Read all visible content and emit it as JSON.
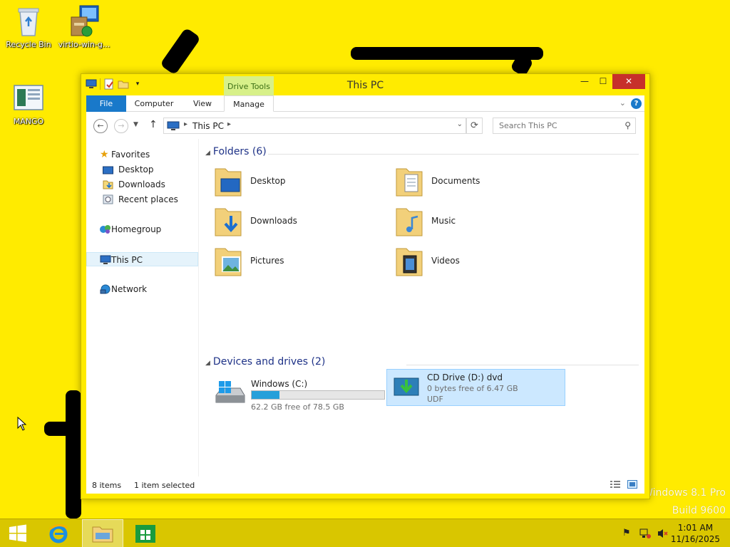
{
  "desktop": {
    "icons": [
      {
        "label": "Recycle Bin",
        "icon": "recycle-bin-icon"
      },
      {
        "label": "virtio-win-g...",
        "icon": "installer-icon"
      },
      {
        "label": "MANGO",
        "icon": "document-icon"
      }
    ],
    "watermark": {
      "line1": "Windows 8.1 Pro",
      "line2": "Build 9600"
    }
  },
  "window": {
    "title": "This PC",
    "context_tab": "Drive Tools",
    "controls": {
      "minimize": "—",
      "maximize": "☐",
      "close": "✕"
    },
    "ribbon_tabs": [
      "File",
      "Computer",
      "View",
      "Manage"
    ],
    "address": {
      "crumb": "This PC"
    },
    "search": {
      "placeholder": "Search This PC"
    }
  },
  "navpane": {
    "favorites": "Favorites",
    "desktop": "Desktop",
    "downloads": "Downloads",
    "recent": "Recent places",
    "homegroup": "Homegroup",
    "thispc": "This PC",
    "network": "Network"
  },
  "main": {
    "folders_header": "Folders (6)",
    "folders": [
      "Desktop",
      "Documents",
      "Downloads",
      "Music",
      "Pictures",
      "Videos"
    ],
    "devices_header": "Devices and drives (2)",
    "drives": [
      {
        "name": "Windows (C:)",
        "free": "62.2 GB free of 78.5 GB",
        "used_fraction": 0.21
      },
      {
        "name": "CD Drive (D:) dvd",
        "free": "0 bytes free of 6.47 GB",
        "fs": "UDF"
      }
    ]
  },
  "status": {
    "items": "8 items",
    "selected": "1 item selected"
  },
  "taskbar": {
    "time": "1:01 AM",
    "date": "11/16/2025"
  },
  "colors": {
    "wallpaper": "#ffeb00",
    "accent": "#1979ca",
    "selection": "#cce8ff",
    "close": "#c7302b"
  }
}
